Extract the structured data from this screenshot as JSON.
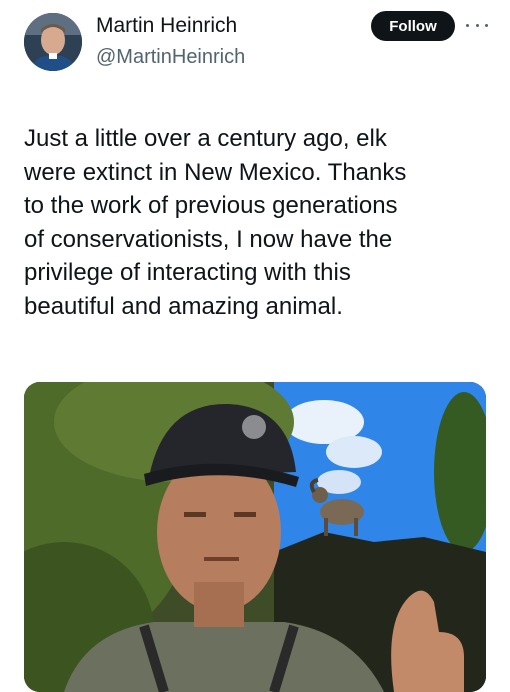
{
  "author": {
    "name": "Martin Heinrich",
    "handle": "@MartinHeinrich",
    "avatar_icon": "person-avatar-icon"
  },
  "actions": {
    "follow_label": "Follow",
    "more_icon": "more-horizontal-icon"
  },
  "tweet": {
    "lines": [
      "Just a little over a century ago, elk",
      "were extinct in New Mexico. Thanks",
      "to the work of previous generations",
      "of conservationists, I now have the",
      "privilege of interacting with this",
      "beautiful and amazing animal."
    ]
  },
  "media": {
    "icon": "photo-selfie-with-bighorn-sheep"
  },
  "colors": {
    "text": "#0f1419",
    "secondary": "#536471",
    "follow_bg": "#0f1419",
    "sky": "#2f86e8"
  }
}
